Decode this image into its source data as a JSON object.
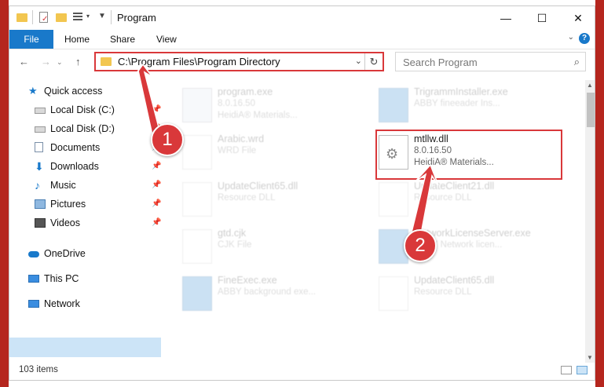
{
  "window": {
    "title": "Program",
    "minimize": "—",
    "maximize": "☐",
    "close": "✕"
  },
  "ribbon": {
    "file": "File",
    "tabs": [
      "Home",
      "Share",
      "View"
    ],
    "expand": "⌄",
    "help": "?"
  },
  "nav": {
    "back": "←",
    "forward": "→",
    "up": "↑"
  },
  "address": {
    "path": "C:\\Program Files\\Program Directory",
    "dropdown": "⌄",
    "refresh": "↻"
  },
  "search": {
    "placeholder": "Search Program",
    "icon": "⌕"
  },
  "sidebar": {
    "items": [
      {
        "label": "Quick access",
        "icon": "star-icon"
      },
      {
        "label": "Local Disk (C:)",
        "icon": "drive-icon"
      },
      {
        "label": "Local Disk (D:)",
        "icon": "drive-icon"
      },
      {
        "label": "Documents",
        "icon": "documents-icon"
      },
      {
        "label": "Downloads",
        "icon": "download-icon"
      },
      {
        "label": "Music",
        "icon": "music-icon"
      },
      {
        "label": "Pictures",
        "icon": "pictures-icon"
      },
      {
        "label": "Videos",
        "icon": "videos-icon"
      },
      {
        "label": "OneDrive",
        "icon": "cloud-icon"
      },
      {
        "label": "This PC",
        "icon": "computer-icon"
      },
      {
        "label": "Network",
        "icon": "network-icon"
      }
    ],
    "pin_glyph": "📌"
  },
  "files": [
    {
      "name": "program.exe",
      "version": "8.0.16.50",
      "desc": "HeidiA® Materials..."
    },
    {
      "name": "TrigrammInstaller.exe",
      "version": "",
      "desc": "ABBY fineeader Ins..."
    },
    {
      "name": "Arabic.wrd",
      "version": "",
      "desc": "WRD File"
    },
    {
      "name": "mtllw.dll",
      "version": "8.0.16.50",
      "desc": "HeidiA® Materials..."
    },
    {
      "name": "UpdateClient65.dll",
      "version": "",
      "desc": "Resource DLL"
    },
    {
      "name": "UpdateClient21.dll",
      "version": "",
      "desc": "Resource DLL"
    },
    {
      "name": "gtd.cjk",
      "version": "",
      "desc": "CJK File"
    },
    {
      "name": "NetworkLicenseServer.exe",
      "version": "",
      "desc": "ABBY Network licen..."
    },
    {
      "name": "FineExec.exe",
      "version": "",
      "desc": "ABBY background exe..."
    },
    {
      "name": "UpdateClient65.dll",
      "version": "",
      "desc": "Resource DLL"
    }
  ],
  "status": {
    "count": "103 items"
  },
  "callouts": [
    "1",
    "2"
  ],
  "colors": {
    "accent": "#1979ca",
    "annotation": "#d9383a",
    "folder": "#f2c650"
  }
}
